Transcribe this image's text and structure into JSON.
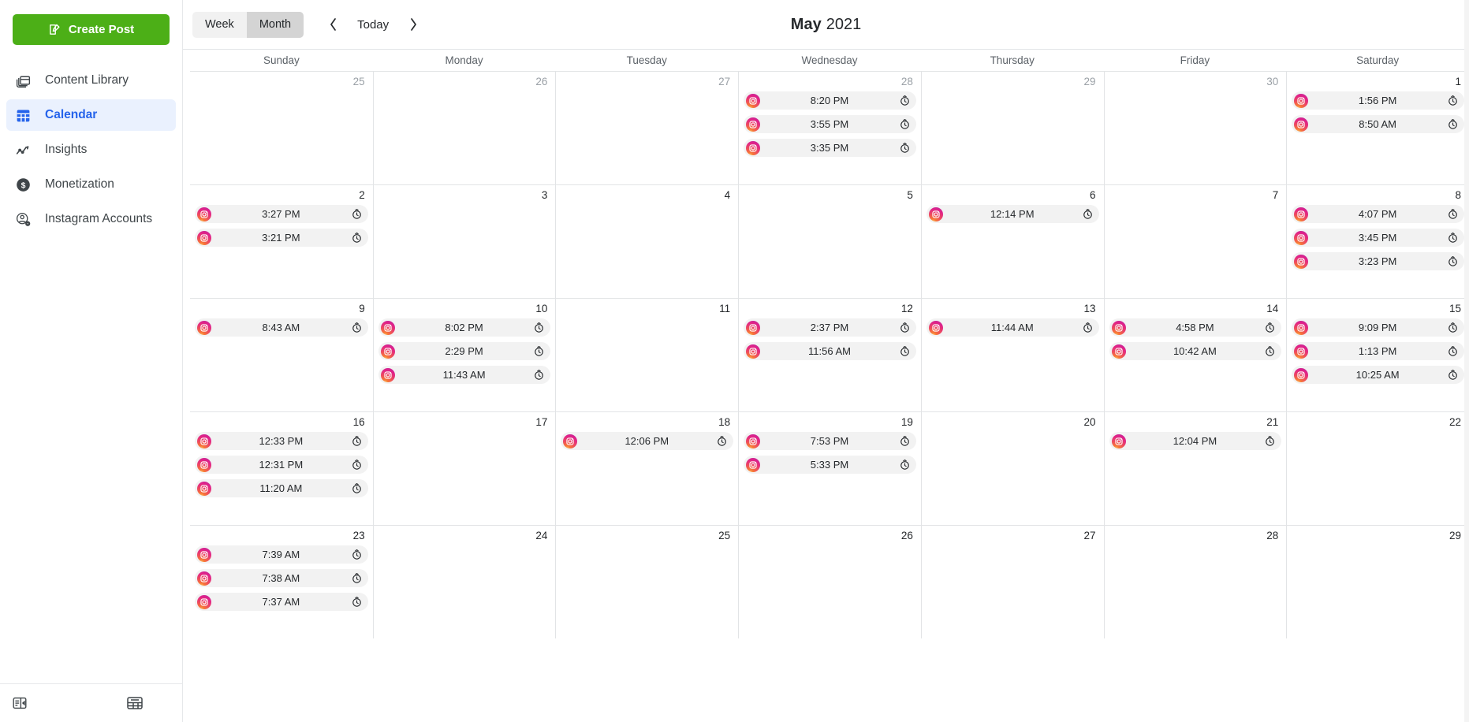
{
  "sidebar": {
    "create_post": {
      "label": "Create Post",
      "icon": "compose-icon",
      "color": "#4caf17"
    },
    "items": [
      {
        "label": "Content Library",
        "icon": "content-library-icon",
        "active": false
      },
      {
        "label": "Calendar",
        "icon": "calendar-icon",
        "active": true
      },
      {
        "label": "Insights",
        "icon": "insights-icon",
        "active": false
      },
      {
        "label": "Monetization",
        "icon": "monetization-icon",
        "active": false
      },
      {
        "label": "Instagram Accounts",
        "icon": "instagram-accounts-icon",
        "active": false
      }
    ],
    "active_color": "#2563eb",
    "footer": [
      {
        "icon": "collapse-sidebar-icon"
      },
      {
        "icon": "table-grid-icon"
      }
    ]
  },
  "toolbar": {
    "week_label": "Week",
    "month_label": "Month",
    "selected_view": "Month",
    "prev_label": "‹",
    "today_label": "Today",
    "next_label": "›"
  },
  "header": {
    "month": "May",
    "year": "2021"
  },
  "calendar": {
    "day_names": [
      "Sunday",
      "Monday",
      "Tuesday",
      "Wednesday",
      "Thursday",
      "Friday",
      "Saturday"
    ],
    "weeks": [
      [
        {
          "date": "25",
          "other_month": true,
          "events": []
        },
        {
          "date": "26",
          "other_month": true,
          "events": []
        },
        {
          "date": "27",
          "other_month": true,
          "events": []
        },
        {
          "date": "28",
          "other_month": true,
          "events": [
            {
              "time": "8:20 PM",
              "platform": "instagram"
            },
            {
              "time": "3:55 PM",
              "platform": "instagram"
            },
            {
              "time": "3:35 PM",
              "platform": "instagram"
            }
          ]
        },
        {
          "date": "29",
          "other_month": true,
          "events": []
        },
        {
          "date": "30",
          "other_month": true,
          "events": []
        },
        {
          "date": "1",
          "other_month": false,
          "events": [
            {
              "time": "1:56 PM",
              "platform": "instagram"
            },
            {
              "time": "8:50 AM",
              "platform": "instagram"
            }
          ]
        }
      ],
      [
        {
          "date": "2",
          "other_month": false,
          "events": [
            {
              "time": "3:27 PM",
              "platform": "instagram"
            },
            {
              "time": "3:21 PM",
              "platform": "instagram"
            }
          ]
        },
        {
          "date": "3",
          "other_month": false,
          "events": []
        },
        {
          "date": "4",
          "other_month": false,
          "events": []
        },
        {
          "date": "5",
          "other_month": false,
          "events": []
        },
        {
          "date": "6",
          "other_month": false,
          "events": [
            {
              "time": "12:14 PM",
              "platform": "instagram"
            }
          ]
        },
        {
          "date": "7",
          "other_month": false,
          "events": []
        },
        {
          "date": "8",
          "other_month": false,
          "events": [
            {
              "time": "4:07 PM",
              "platform": "instagram"
            },
            {
              "time": "3:45 PM",
              "platform": "instagram"
            },
            {
              "time": "3:23 PM",
              "platform": "instagram"
            }
          ]
        }
      ],
      [
        {
          "date": "9",
          "other_month": false,
          "events": [
            {
              "time": "8:43 AM",
              "platform": "instagram"
            }
          ]
        },
        {
          "date": "10",
          "other_month": false,
          "events": [
            {
              "time": "8:02 PM",
              "platform": "instagram"
            },
            {
              "time": "2:29 PM",
              "platform": "instagram"
            },
            {
              "time": "11:43 AM",
              "platform": "instagram"
            }
          ]
        },
        {
          "date": "11",
          "other_month": false,
          "events": []
        },
        {
          "date": "12",
          "other_month": false,
          "events": [
            {
              "time": "2:37 PM",
              "platform": "instagram"
            },
            {
              "time": "11:56 AM",
              "platform": "instagram"
            }
          ]
        },
        {
          "date": "13",
          "other_month": false,
          "events": [
            {
              "time": "11:44 AM",
              "platform": "instagram"
            }
          ]
        },
        {
          "date": "14",
          "other_month": false,
          "events": [
            {
              "time": "4:58 PM",
              "platform": "instagram"
            },
            {
              "time": "10:42 AM",
              "platform": "instagram"
            }
          ]
        },
        {
          "date": "15",
          "other_month": false,
          "events": [
            {
              "time": "9:09 PM",
              "platform": "instagram"
            },
            {
              "time": "1:13 PM",
              "platform": "instagram"
            },
            {
              "time": "10:25 AM",
              "platform": "instagram"
            }
          ]
        }
      ],
      [
        {
          "date": "16",
          "other_month": false,
          "events": [
            {
              "time": "12:33 PM",
              "platform": "instagram"
            },
            {
              "time": "12:31 PM",
              "platform": "instagram"
            },
            {
              "time": "11:20 AM",
              "platform": "instagram"
            }
          ]
        },
        {
          "date": "17",
          "other_month": false,
          "events": []
        },
        {
          "date": "18",
          "other_month": false,
          "events": [
            {
              "time": "12:06 PM",
              "platform": "instagram"
            }
          ]
        },
        {
          "date": "19",
          "other_month": false,
          "events": [
            {
              "time": "7:53 PM",
              "platform": "instagram"
            },
            {
              "time": "5:33 PM",
              "platform": "instagram"
            }
          ]
        },
        {
          "date": "20",
          "other_month": false,
          "events": []
        },
        {
          "date": "21",
          "other_month": false,
          "events": [
            {
              "time": "12:04 PM",
              "platform": "instagram"
            }
          ]
        },
        {
          "date": "22",
          "other_month": false,
          "events": []
        }
      ],
      [
        {
          "date": "23",
          "other_month": false,
          "events": [
            {
              "time": "7:39 AM",
              "platform": "instagram"
            },
            {
              "time": "7:38 AM",
              "platform": "instagram"
            },
            {
              "time": "7:37 AM",
              "platform": "instagram"
            }
          ]
        },
        {
          "date": "24",
          "other_month": false,
          "events": []
        },
        {
          "date": "25",
          "other_month": false,
          "events": []
        },
        {
          "date": "26",
          "other_month": false,
          "events": []
        },
        {
          "date": "27",
          "other_month": false,
          "events": []
        },
        {
          "date": "28",
          "other_month": false,
          "events": []
        },
        {
          "date": "29",
          "other_month": false,
          "events": []
        }
      ]
    ],
    "event_icon": "instagram-icon",
    "event_action_icon": "schedule-history-icon"
  }
}
